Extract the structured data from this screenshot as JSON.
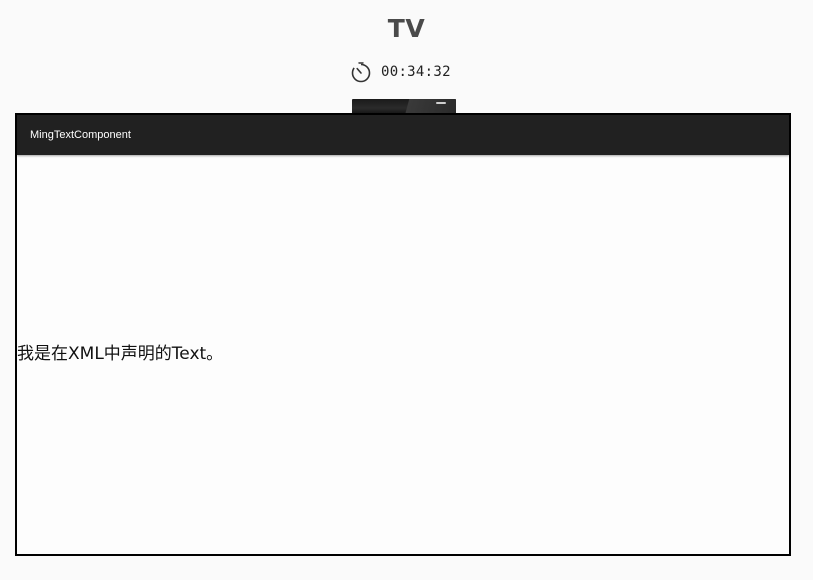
{
  "device": {
    "title": "TV",
    "elapsed_time": "00:34:32",
    "timer_icon": "stopwatch-icon"
  },
  "app": {
    "toolbar_title": "MingTextComponent",
    "body_text": "我是在XML中声明的Text。"
  },
  "colors": {
    "app_bar": "#212121",
    "screen_background": "#fdfdfd",
    "page_background": "#fafafa",
    "frame": "#000000"
  }
}
